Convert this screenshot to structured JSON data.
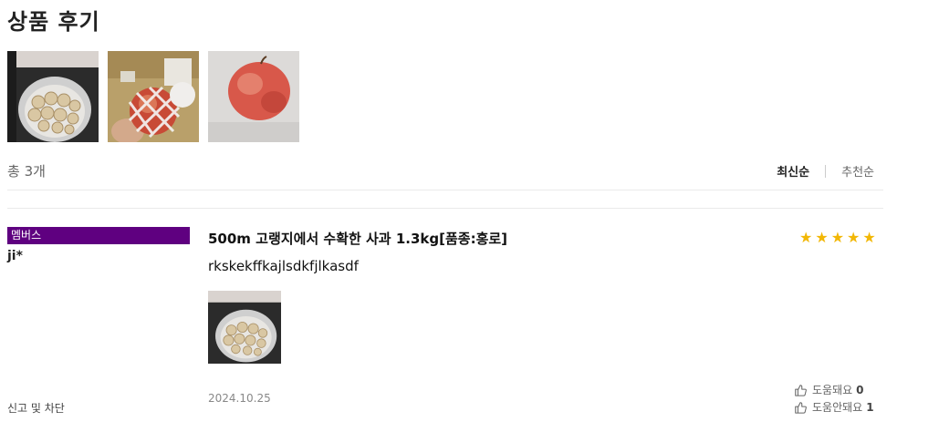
{
  "section": {
    "title": "상품 후기"
  },
  "thumbnails": [
    {
      "icon": "air-fryer-photo"
    },
    {
      "icon": "apple-net-photo"
    },
    {
      "icon": "apple-photo"
    }
  ],
  "summary": {
    "count_label": "총 3개",
    "sort_options": [
      "최신순",
      "추천순"
    ],
    "active_sort": "최신순"
  },
  "review": {
    "badge": "멤버스",
    "author": "ji*",
    "product_name": "500m 고랭지에서 수확한 사과 1.3kg[품종:홍로]",
    "rating": 5,
    "rating_glyphs": [
      "★",
      "★",
      "★",
      "★",
      "★"
    ],
    "text": "rkskekffkajlsdkfjlkasdf",
    "date": "2024.10.25",
    "report_label": "신고 및 차단",
    "helpful_label": "도움돼요",
    "helpful_count": "0",
    "unhelpful_label": "도움안돼요",
    "unhelpful_count": "1",
    "colors": {
      "badge_bg": "#5f0080",
      "star": "#f2b705"
    }
  }
}
